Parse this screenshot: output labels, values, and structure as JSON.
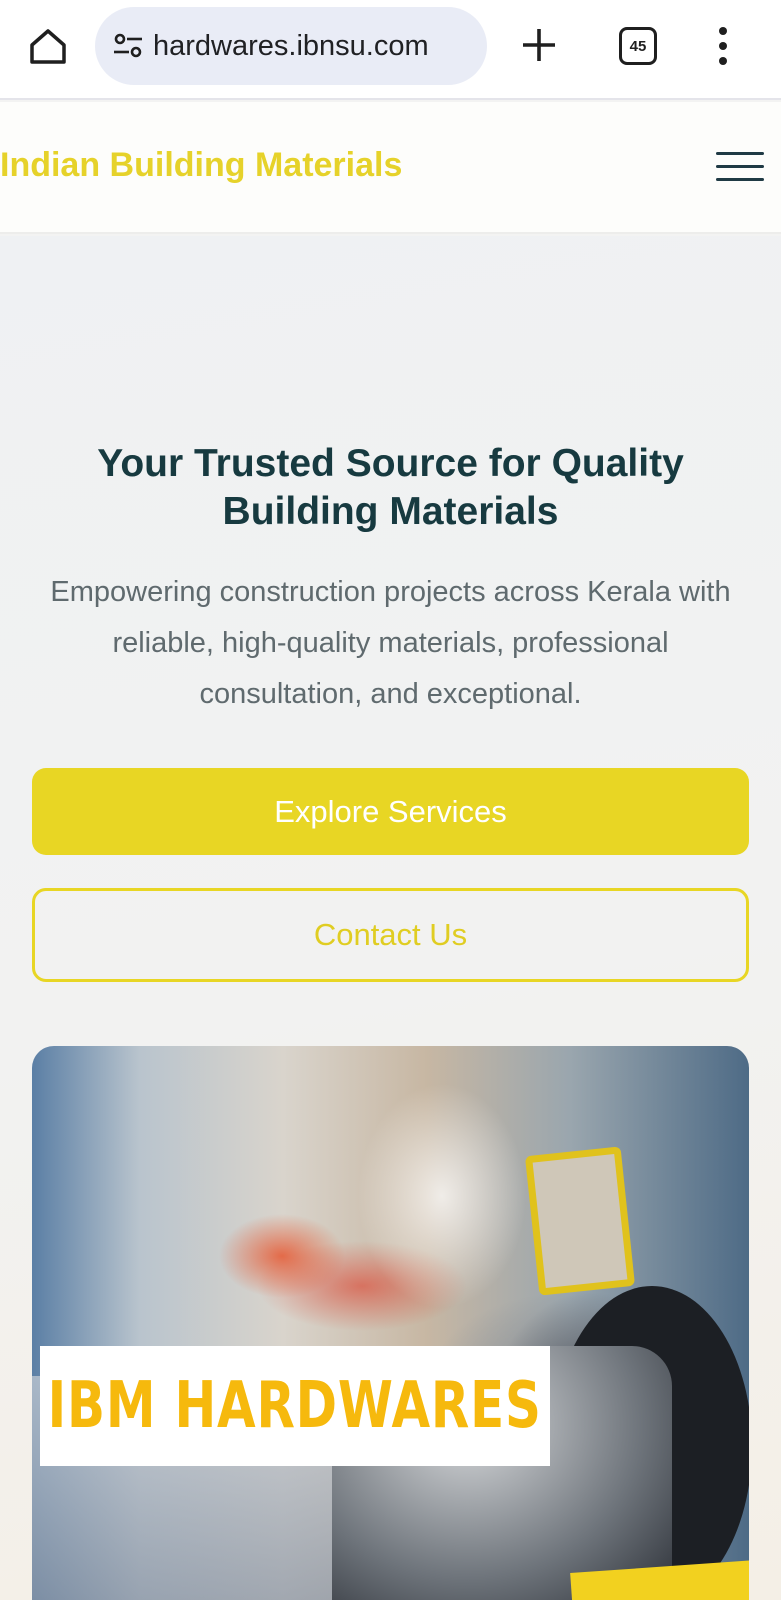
{
  "browser": {
    "url": "hardwares.ibnsu.com",
    "tab_count": "45",
    "icons": [
      "home-icon",
      "site-settings-icon",
      "new-tab-icon",
      "tab-switcher-icon",
      "more-options-icon"
    ]
  },
  "site": {
    "logo_text": "Indian Building Materials",
    "menu_icon": "hamburger-menu-icon"
  },
  "hero": {
    "headline": "Your Trusted Source for Quality Building Materials",
    "subtext": "Empowering construction projects across Kerala with reliable, high-quality materials, professional consultation, and exceptional.",
    "primary_button": "Explore Services",
    "secondary_button": "Contact Us",
    "image_banner_text": "IBM HARDWARES"
  },
  "colors": {
    "accent": "#e8d624",
    "heading": "#173a40",
    "body_text": "#5f6a6e",
    "banner_text": "#f6b90d"
  }
}
